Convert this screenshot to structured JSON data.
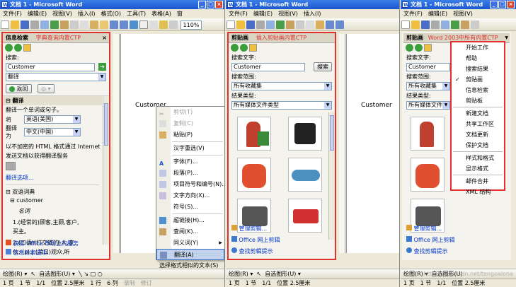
{
  "window": {
    "title": "文档 1 - Microsoft Word"
  },
  "menus": {
    "pane1": [
      "文件(F)",
      "编辑(E)",
      "视图(V)",
      "插入(I)",
      "格式(O)",
      "工具(T)",
      "表格(A)",
      "窗"
    ],
    "pane2": [
      "文件(F)",
      "编辑(E)",
      "视图(V)",
      "插入(I)"
    ],
    "pane3": [
      "文件(F)",
      "编辑(E)",
      "视图(V)"
    ]
  },
  "toolbar": {
    "zoom": "110%"
  },
  "research": {
    "pane_title": "信息检索",
    "annotation": "字典查询内置CTP",
    "search_label": "搜索:",
    "search_value": "Customer",
    "source": "翻译",
    "back_label": "返回",
    "section_title": "翻译",
    "desc": "翻译一个单词或句子。",
    "from_label": "将",
    "from_lang": "英语(美国)",
    "to_label": "翻译为",
    "to_lang": "中文(中国)",
    "note_line1": "以不加密的 HTML 格式通过 Internet",
    "note_line2": "发送文档以获得翻译服务",
    "options_link": "翻译选项...",
    "dict_header": "双语词典",
    "dict_word": "customer",
    "dict_pos": "名词",
    "def1_line1": "1.(经常的)顾客,主顾,客户,",
    "def1_line2": "买主。",
    "def2_line1": "2.(口语)(打交道的)人,家",
    "def2_line2": "伙: (pl.) (美口)观众,听",
    "footer_link1": "获取 Office 市场上的服务",
    "footer_link2": "信息检索选项..."
  },
  "doc": {
    "text": "Customer"
  },
  "context_menu": {
    "items": [
      "剪切(T)",
      "复制(C)",
      "粘贴(P)",
      "汉字重选(V)",
      "字体(F)...",
      "段落(P)...",
      "项目符号和编号(N)...",
      "文字方向(X)...",
      "符号(S)...",
      "超链接(H)...",
      "查阅(K)...",
      "同义词(Y)",
      "翻译(A)",
      "选择格式相似的文本(S)"
    ]
  },
  "clipart": {
    "pane_title": "剪贴画",
    "annotation": "插入剪贴画内置CTP",
    "search_label": "搜索文字:",
    "search_value": "Customer",
    "search_button": "搜索",
    "scope_label": "搜索范围:",
    "scope_value": "所有收藏集",
    "type_label": "结果类型:",
    "type_value": "所有媒体文件类型",
    "link_organize": "管理剪辑...",
    "link_online": "Office 网上剪辑",
    "link_tips": "查找剪辑提示"
  },
  "ctp_list": {
    "pane_title": "剪贴画",
    "annotation": "Word 2003中所有内置CTP",
    "items": [
      "开始工作",
      "帮助",
      "搜索结果",
      "剪贴画",
      "信息检索",
      "剪贴板",
      "新建文档",
      "共享工作区",
      "文档更新",
      "保护文档",
      "样式和格式",
      "显示格式",
      "邮件合并",
      "XML 结构"
    ]
  },
  "status": {
    "page": "1 页",
    "section": "1 节",
    "pagecount": "1/1",
    "position": "位置 2.5厘米",
    "line": "1 行",
    "col": "6 列",
    "rec": "录制",
    "rev": "修订"
  },
  "drawbar": {
    "draw": "绘图(R)",
    "autoshapes": "自选图形(U)"
  },
  "watermark": "http://blog.csdn.net/tengoalone"
}
